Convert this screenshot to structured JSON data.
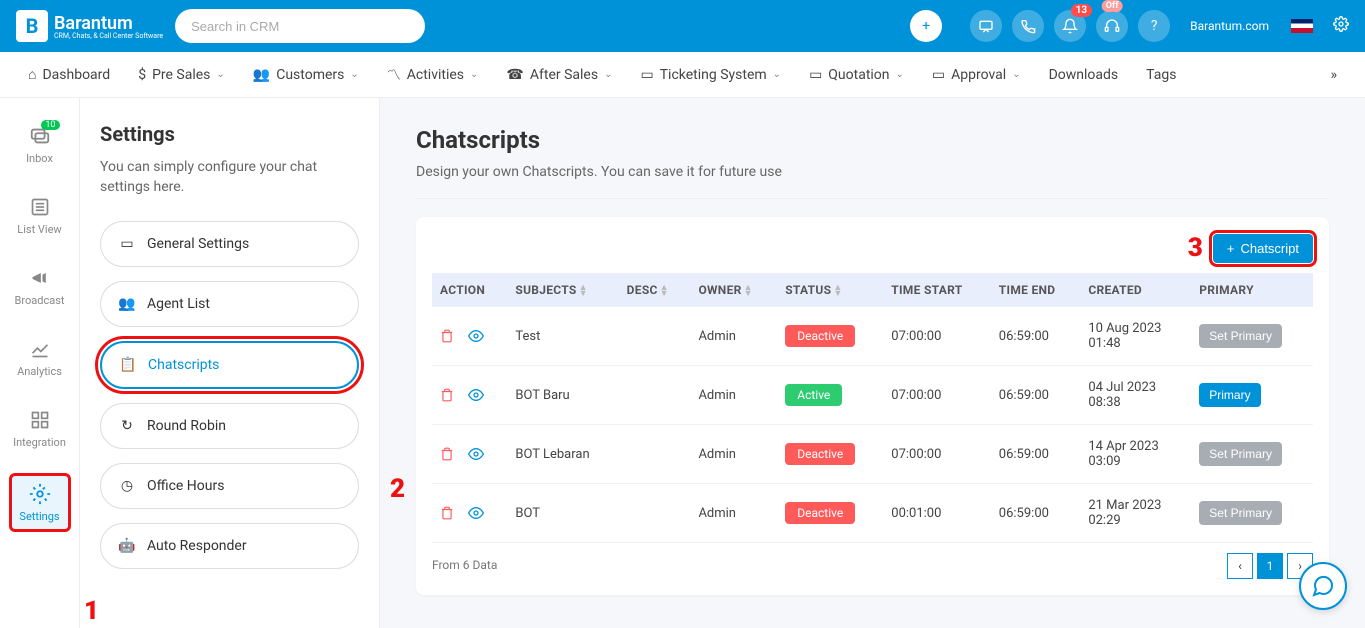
{
  "header": {
    "brand": "Barantum",
    "brand_sub": "CRM, Chats, & Call Center Software",
    "search_placeholder": "Search in CRM",
    "brand_link": "Barantum.com",
    "notif_count": "13",
    "offline": "Off"
  },
  "nav": [
    {
      "label": "Dashboard",
      "caret": false
    },
    {
      "label": "Pre Sales",
      "caret": true
    },
    {
      "label": "Customers",
      "caret": true
    },
    {
      "label": "Activities",
      "caret": true
    },
    {
      "label": "After Sales",
      "caret": true
    },
    {
      "label": "Ticketing System",
      "caret": true
    },
    {
      "label": "Quotation",
      "caret": true
    },
    {
      "label": "Approval",
      "caret": true
    },
    {
      "label": "Downloads",
      "caret": false
    },
    {
      "label": "Tags",
      "caret": false
    }
  ],
  "rail": [
    {
      "label": "Inbox",
      "badge": "10",
      "key": "inbox"
    },
    {
      "label": "List View",
      "key": "list"
    },
    {
      "label": "Broadcast",
      "key": "broadcast"
    },
    {
      "label": "Analytics",
      "key": "analytics"
    },
    {
      "label": "Integration",
      "key": "integration"
    },
    {
      "label": "Settings",
      "key": "settings"
    }
  ],
  "sidebar": {
    "title": "Settings",
    "desc": "You can simply configure your chat settings here.",
    "items": [
      {
        "label": "General Settings",
        "key": "general"
      },
      {
        "label": "Agent List",
        "key": "agents"
      },
      {
        "label": "Chatscripts",
        "key": "chatscripts"
      },
      {
        "label": "Round Robin",
        "key": "robin"
      },
      {
        "label": "Office Hours",
        "key": "hours"
      },
      {
        "label": "Auto Responder",
        "key": "autoresp"
      }
    ]
  },
  "page": {
    "title": "Chatscripts",
    "subtitle": "Design your own Chatscripts. You can save it for future use",
    "add_btn": "Chatscript",
    "from_data": "From 6 Data"
  },
  "table": {
    "headers": {
      "action": "ACTION",
      "subjects": "SUBJECTS",
      "desc": "DESC",
      "owner": "OWNER",
      "status": "STATUS",
      "time_start": "TIME START",
      "time_end": "TIME END",
      "created": "CREATED",
      "primary": "PRIMARY"
    },
    "rows": [
      {
        "subject": "Test",
        "desc": "",
        "owner": "Admin",
        "status": "Deactive",
        "time_start": "07:00:00",
        "time_end": "06:59:00",
        "created": "10 Aug 2023 01:48",
        "primary_label": "Set Primary",
        "primary_type": "gray"
      },
      {
        "subject": "BOT Baru",
        "desc": "",
        "owner": "Admin",
        "status": "Active",
        "time_start": "07:00:00",
        "time_end": "06:59:00",
        "created": "04 Jul 2023 08:38",
        "primary_label": "Primary",
        "primary_type": "blue"
      },
      {
        "subject": "BOT Lebaran",
        "desc": "",
        "owner": "Admin",
        "status": "Deactive",
        "time_start": "07:00:00",
        "time_end": "06:59:00",
        "created": "14 Apr 2023 03:09",
        "primary_label": "Set Primary",
        "primary_type": "gray"
      },
      {
        "subject": "BOT",
        "desc": "",
        "owner": "Admin",
        "status": "Deactive",
        "time_start": "00:01:00",
        "time_end": "06:59:00",
        "created": "21 Mar 2023 02:29",
        "primary_label": "Set Primary",
        "primary_type": "gray"
      }
    ]
  },
  "pagination": {
    "current": "1"
  },
  "annotations": {
    "a1": "1",
    "a2": "2",
    "a3": "3"
  },
  "colors": {
    "accent": "#0092d8",
    "danger": "#ff5a5a",
    "success": "#2ecc71",
    "highlight": "#e11"
  }
}
